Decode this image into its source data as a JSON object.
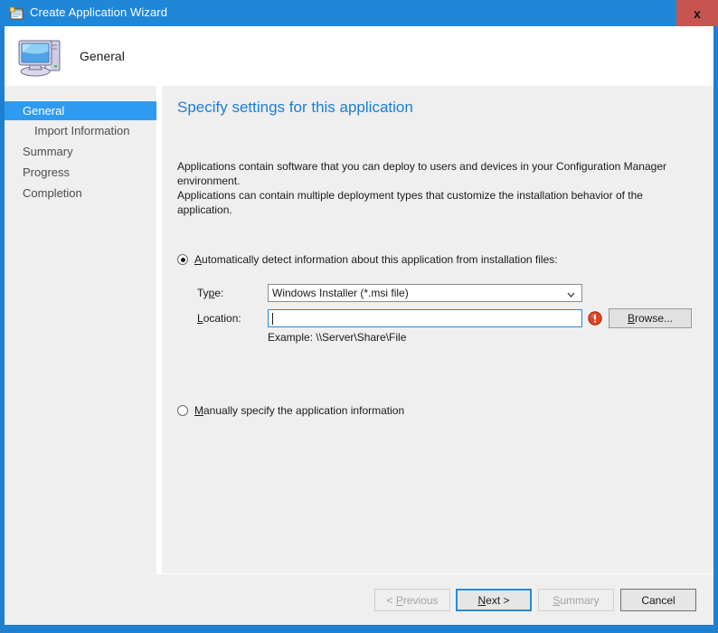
{
  "window": {
    "title": "Create Application Wizard",
    "title_icon": "wizard-window-icon",
    "close_label": "x",
    "accent_color": "#1f86d8",
    "close_color": "#c75450"
  },
  "header": {
    "page_name": "General",
    "icon": "computer-icon"
  },
  "sidebar": {
    "items": [
      {
        "label": "General",
        "selected": true,
        "indent": false
      },
      {
        "label": "Import Information",
        "selected": false,
        "indent": true
      },
      {
        "label": "Summary",
        "selected": false,
        "indent": false
      },
      {
        "label": "Progress",
        "selected": false,
        "indent": false
      },
      {
        "label": "Completion",
        "selected": false,
        "indent": false
      }
    ],
    "selected_color": "#2f9bf0"
  },
  "content": {
    "heading": "Specify settings for this application",
    "heading_color": "#1a7ed6",
    "intro_line1": "Applications contain software that you can deploy to users and devices in your Configuration Manager environment.",
    "intro_line2": "Applications can contain multiple deployment types that customize the installation behavior of the application.",
    "option_auto": {
      "accel": "A",
      "label_rest": "utomatically detect information about this application from installation files:",
      "checked": true
    },
    "option_manual": {
      "accel": "M",
      "label_rest": "anually specify the application information",
      "checked": false
    },
    "type_field": {
      "label_pre": "Ty",
      "label_accel": "p",
      "label_post": "e:",
      "value": "Windows Installer (*.msi file)",
      "arrow_icon": "chevron-down-icon"
    },
    "location_field": {
      "label_accel": "L",
      "label_post": "ocation:",
      "value": "",
      "placeholder": "",
      "error_icon": "error-exclamation-icon",
      "browse_accel": "B",
      "browse_rest": "rowse...",
      "error_color": "#e04321"
    },
    "example_text": "Example: \\\\Server\\Share\\File"
  },
  "footer": {
    "buttons": [
      {
        "name": "previous",
        "text_pre": "< ",
        "accel": "P",
        "text_post": "revious",
        "state": "disabled"
      },
      {
        "name": "next",
        "text_pre": "",
        "accel": "N",
        "text_post": "ext >",
        "state": "default"
      },
      {
        "name": "summary",
        "text_pre": "",
        "accel": "S",
        "text_post": "ummary",
        "state": "disabled"
      },
      {
        "name": "cancel",
        "text_pre": "",
        "accel": "",
        "text_post": "Cancel",
        "state": "strong"
      }
    ]
  }
}
